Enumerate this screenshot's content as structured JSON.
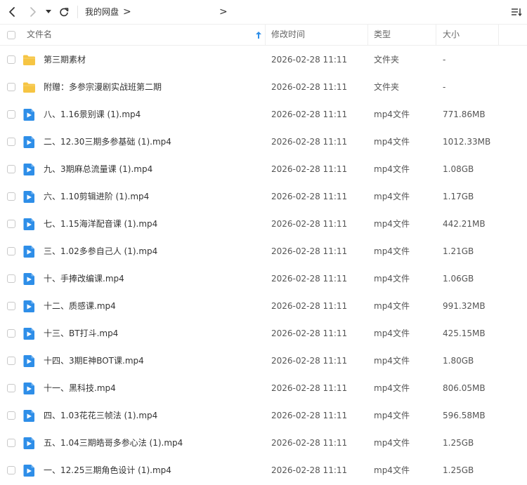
{
  "toolbar": {
    "breadcrumb": "我的网盘",
    "icons": [
      "chevron-left-icon",
      "chevron-right-icon",
      "dropdown-caret-icon",
      "refresh-icon",
      "sort-list-icon"
    ]
  },
  "columns": {
    "name": "文件名",
    "modified": "修改时间",
    "type": "类型",
    "size": "大小"
  },
  "colors": {
    "folder": "#F6C543",
    "video": "#2E8EE8",
    "sort_arrow": "#2E8EE8"
  },
  "files": [
    {
      "name": "第三期素材",
      "modified": "2026-02-28 11:11",
      "type": "文件夹",
      "size": "-",
      "icon": "folder-icon"
    },
    {
      "name": "附赠：多参宗漫剧实战班第二期",
      "modified": "2026-02-28 11:11",
      "type": "文件夹",
      "size": "-",
      "icon": "folder-icon"
    },
    {
      "name": "八、1.16景别课 (1).mp4",
      "modified": "2026-02-28 11:11",
      "type": "mp4文件",
      "size": "771.86MB",
      "icon": "video-file-icon"
    },
    {
      "name": "二、12.30三期多参基础 (1).mp4",
      "modified": "2026-02-28 11:11",
      "type": "mp4文件",
      "size": "1012.33MB",
      "icon": "video-file-icon"
    },
    {
      "name": "九、3期麻总流量课 (1).mp4",
      "modified": "2026-02-28 11:11",
      "type": "mp4文件",
      "size": "1.08GB",
      "icon": "video-file-icon"
    },
    {
      "name": "六、1.10剪辑进阶 (1).mp4",
      "modified": "2026-02-28 11:11",
      "type": "mp4文件",
      "size": "1.17GB",
      "icon": "video-file-icon"
    },
    {
      "name": "七、1.15海洋配音课 (1).mp4",
      "modified": "2026-02-28 11:11",
      "type": "mp4文件",
      "size": "442.21MB",
      "icon": "video-file-icon"
    },
    {
      "name": "三、1.02多参自己人 (1).mp4",
      "modified": "2026-02-28 11:11",
      "type": "mp4文件",
      "size": "1.21GB",
      "icon": "video-file-icon"
    },
    {
      "name": "十、手捧改编课.mp4",
      "modified": "2026-02-28 11:11",
      "type": "mp4文件",
      "size": "1.06GB",
      "icon": "video-file-icon"
    },
    {
      "name": "十二、质感课.mp4",
      "modified": "2026-02-28 11:11",
      "type": "mp4文件",
      "size": "991.32MB",
      "icon": "video-file-icon"
    },
    {
      "name": "十三、BT打斗.mp4",
      "modified": "2026-02-28 11:11",
      "type": "mp4文件",
      "size": "425.15MB",
      "icon": "video-file-icon"
    },
    {
      "name": "十四、3期E神BOT课.mp4",
      "modified": "2026-02-28 11:11",
      "type": "mp4文件",
      "size": "1.80GB",
      "icon": "video-file-icon"
    },
    {
      "name": "十一、黑科技.mp4",
      "modified": "2026-02-28 11:11",
      "type": "mp4文件",
      "size": "806.05MB",
      "icon": "video-file-icon"
    },
    {
      "name": "四、1.03花花三帧法 (1).mp4",
      "modified": "2026-02-28 11:11",
      "type": "mp4文件",
      "size": "596.58MB",
      "icon": "video-file-icon"
    },
    {
      "name": "五、1.04三期皓哥多参心法 (1).mp4",
      "modified": "2026-02-28 11:11",
      "type": "mp4文件",
      "size": "1.25GB",
      "icon": "video-file-icon"
    },
    {
      "name": "一、12.25三期角色设计 (1).mp4",
      "modified": "2026-02-28 11:11",
      "type": "mp4文件",
      "size": "1.25GB",
      "icon": "video-file-icon"
    }
  ]
}
